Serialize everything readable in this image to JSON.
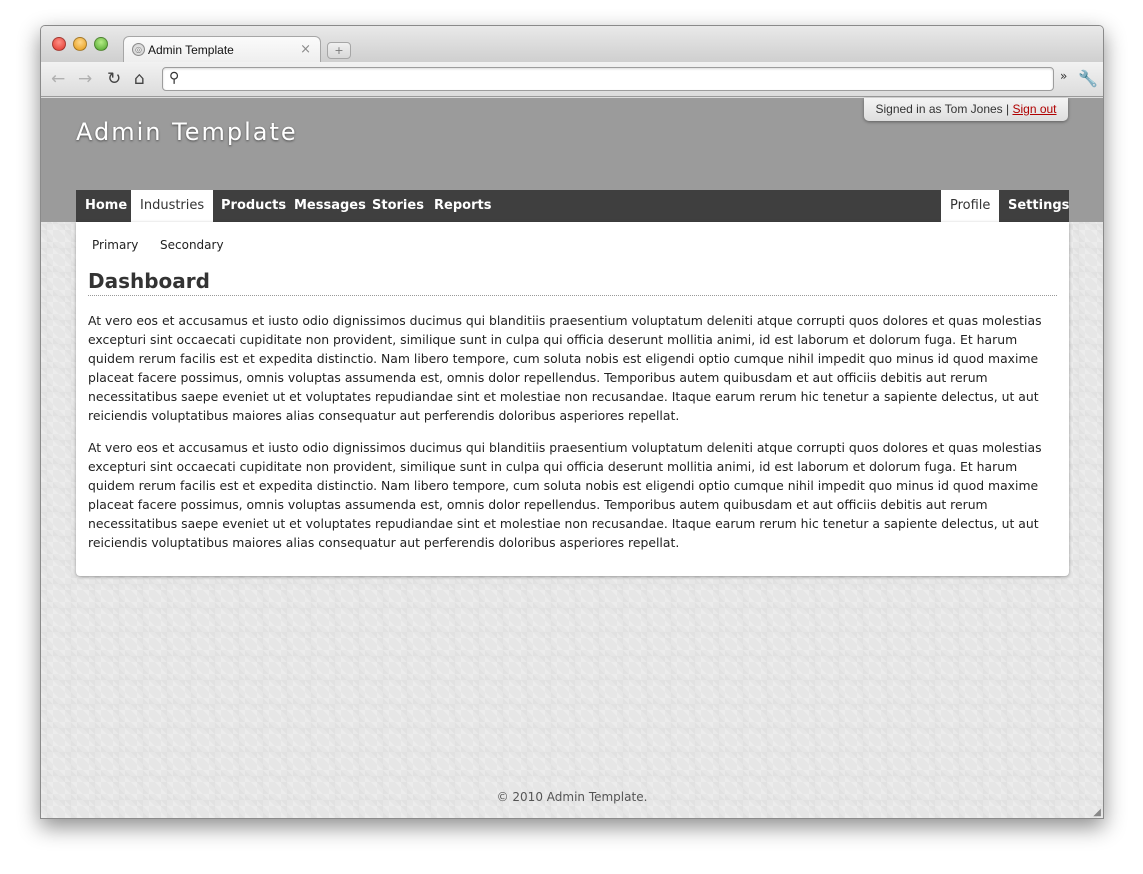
{
  "browser": {
    "tab_title": "Admin Template",
    "tab_close_glyph": "×",
    "newtab_glyph": "+",
    "back_glyph": "←",
    "forward_glyph": "→",
    "reload_glyph": "↻",
    "home_glyph": "⌂",
    "search_glyph": "⚲",
    "chevron_glyph": "»",
    "wrench_glyph": "🔧",
    "favicon_glyph": "◎",
    "address_value": ""
  },
  "header": {
    "site_title": "Admin Template",
    "signed_in_text": "Signed in as Tom Jones |",
    "signout_label": "Sign out"
  },
  "nav": {
    "items": [
      {
        "label": "Home"
      },
      {
        "label": "Industries"
      },
      {
        "label": "Products"
      },
      {
        "label": "Messages"
      },
      {
        "label": "Stories"
      },
      {
        "label": "Reports"
      }
    ],
    "right_items": [
      {
        "label": "Profile"
      },
      {
        "label": "Settings"
      }
    ]
  },
  "subnav": {
    "items": [
      {
        "label": "Primary"
      },
      {
        "label": "Secondary"
      }
    ]
  },
  "main": {
    "heading": "Dashboard",
    "paragraphs": [
      "At vero eos et accusamus et iusto odio dignissimos ducimus qui blanditiis praesentium voluptatum deleniti atque corrupti quos dolores et quas molestias excepturi sint occaecati cupiditate non provident, similique sunt in culpa qui officia deserunt mollitia animi, id est laborum et dolorum fuga. Et harum quidem rerum facilis est et expedita distinctio. Nam libero tempore, cum soluta nobis est eligendi optio cumque nihil impedit quo minus id quod maxime placeat facere possimus, omnis voluptas assumenda est, omnis dolor repellendus. Temporibus autem quibusdam et aut officiis debitis aut rerum necessitatibus saepe eveniet ut et voluptates repudiandae sint et molestiae non recusandae. Itaque earum rerum hic tenetur a sapiente delectus, ut aut reiciendis voluptatibus maiores alias consequatur aut perferendis doloribus asperiores repellat.",
      "At vero eos et accusamus et iusto odio dignissimos ducimus qui blanditiis praesentium voluptatum deleniti atque corrupti quos dolores et quas molestias excepturi sint occaecati cupiditate non provident, similique sunt in culpa qui officia deserunt mollitia animi, id est laborum et dolorum fuga. Et harum quidem rerum facilis est et expedita distinctio. Nam libero tempore, cum soluta nobis est eligendi optio cumque nihil impedit quo minus id quod maxime placeat facere possimus, omnis voluptas assumenda est, omnis dolor repellendus. Temporibus autem quibusdam et aut officiis debitis aut rerum necessitatibus saepe eveniet ut et voluptates repudiandae sint et molestiae non recusandae. Itaque earum rerum hic tenetur a sapiente delectus, ut aut reiciendis voluptatibus maiores alias consequatur aut perferendis doloribus asperiores repellat."
    ]
  },
  "footer": {
    "text": "© 2010 Admin Template."
  },
  "colors": {
    "header_band": "#9b9b9b",
    "nav_bar": "#3f3f3f",
    "signout_link": "#b00000"
  }
}
